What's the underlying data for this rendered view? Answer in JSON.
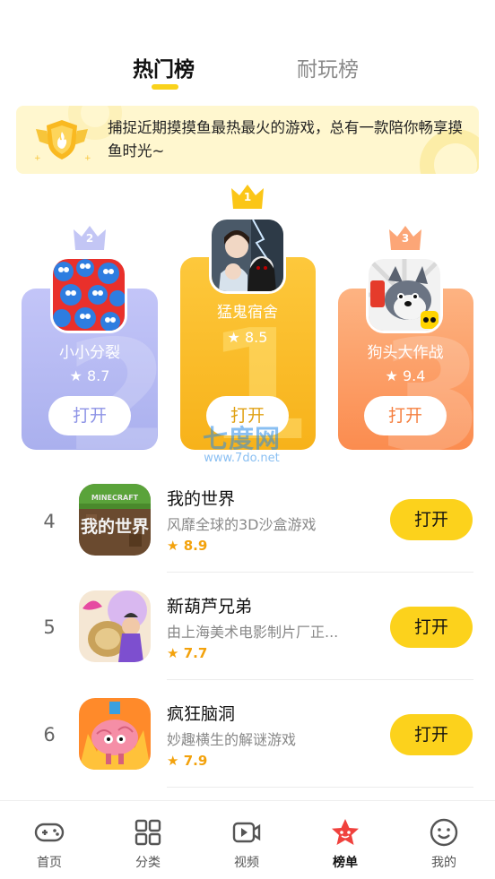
{
  "tabs": [
    {
      "label": "热门榜",
      "active": true
    },
    {
      "label": "耐玩榜",
      "active": false
    }
  ],
  "banner": {
    "text": "捕捉近期摸摸鱼最热最火的游戏，总有一款陪你畅享摸鱼时光~",
    "icon": "trophy-badge-icon"
  },
  "podium": [
    {
      "rank": "2",
      "name": "小小分裂",
      "rating": "8.7",
      "open_label": "打开",
      "color": "#aab0ee",
      "text_color": "#8d93e6"
    },
    {
      "rank": "1",
      "name": "猛鬼宿舍",
      "rating": "8.5",
      "open_label": "打开",
      "color": "#f7b21a",
      "text_color": "#e0a114"
    },
    {
      "rank": "3",
      "name": "狗头大作战",
      "rating": "9.4",
      "open_label": "打开",
      "color": "#fb8c4f",
      "text_color": "#f57f3f"
    }
  ],
  "list": [
    {
      "rank": "4",
      "title": "我的世界",
      "desc": "风靡全球的3D沙盒游戏",
      "rating": "8.9",
      "open_label": "打开"
    },
    {
      "rank": "5",
      "title": "新葫芦兄弟",
      "desc": "由上海美术电影制片厂正...",
      "rating": "7.7",
      "open_label": "打开"
    },
    {
      "rank": "6",
      "title": "疯狂脑洞",
      "desc": "妙趣横生的解谜游戏",
      "rating": "7.9",
      "open_label": "打开"
    }
  ],
  "watermark": {
    "big": "七度网",
    "small": "www.7do.net"
  },
  "nav": [
    {
      "label": "首页",
      "icon": "gamepad-icon"
    },
    {
      "label": "分类",
      "icon": "grid-icon"
    },
    {
      "label": "视频",
      "icon": "video-icon"
    },
    {
      "label": "榜单",
      "icon": "star-rank-icon",
      "active": true
    },
    {
      "label": "我的",
      "icon": "smiley-icon"
    }
  ],
  "colors": {
    "accent": "#fcd21c",
    "star": "#f3a20c"
  }
}
